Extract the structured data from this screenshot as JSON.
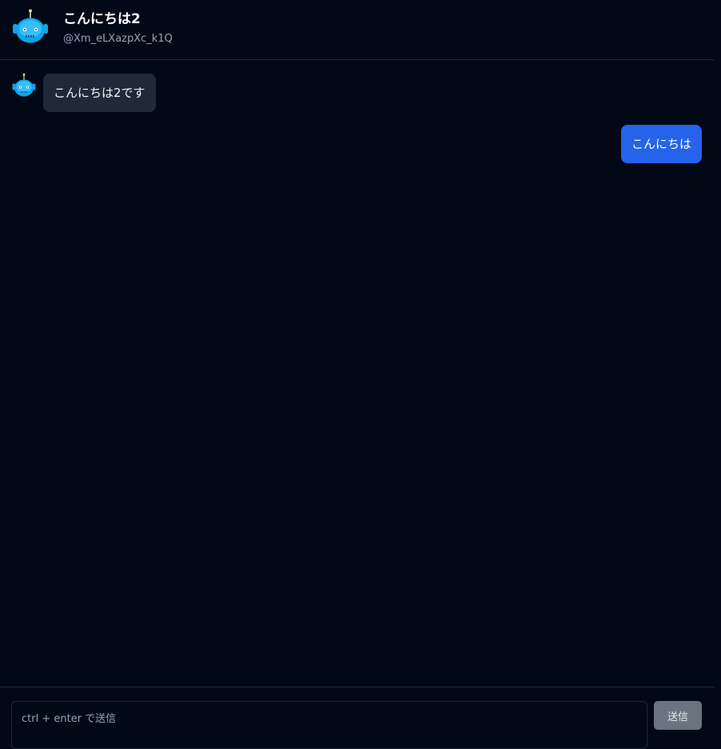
{
  "header": {
    "title": "こんにちは2",
    "handle": "@Xm_eLXazpXc_k1Q",
    "avatar_icon": "robot-icon"
  },
  "messages": [
    {
      "sender": "bot",
      "text": "こんにちは2です",
      "avatar_icon": "robot-icon"
    },
    {
      "sender": "user",
      "text": "こんにちは"
    }
  ],
  "composer": {
    "placeholder": "ctrl + enter で送信",
    "value": "",
    "send_label": "送信"
  },
  "colors": {
    "background": "#030817",
    "user_bubble": "#2563eb",
    "bot_bubble": "#1f2937",
    "robot_blue": "#0ea5e9",
    "send_button": "#6b7280"
  }
}
